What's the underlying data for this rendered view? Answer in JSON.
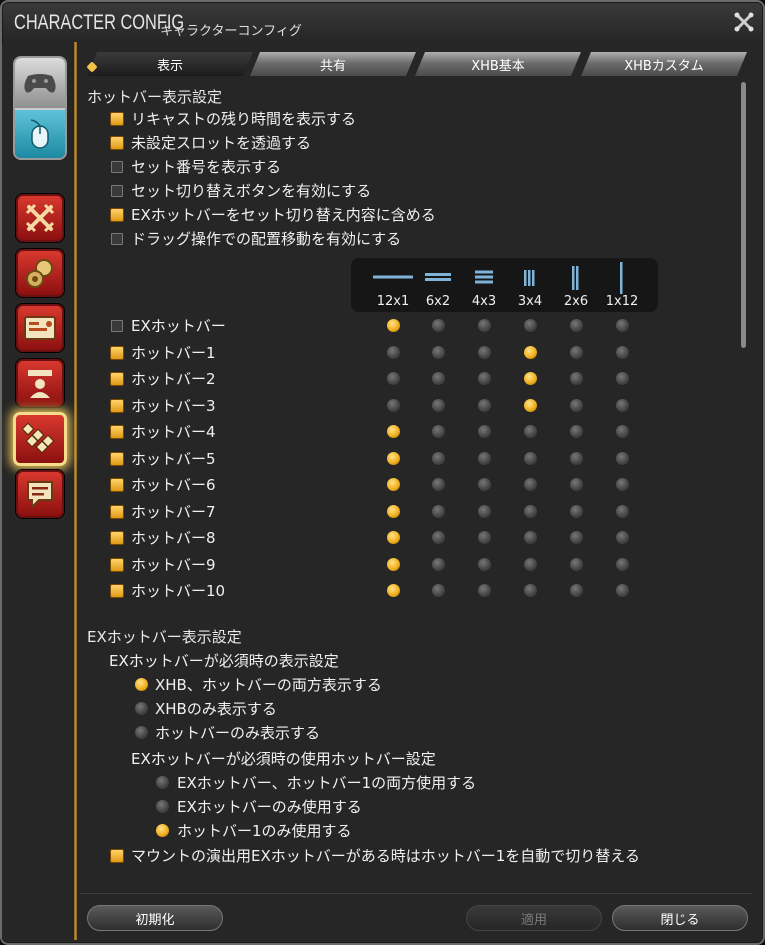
{
  "window": {
    "title_en": "CHARACTER CONFIG",
    "title_jp": "キャラクターコンフィグ"
  },
  "tabs": [
    {
      "label": "表示",
      "active": true
    },
    {
      "label": "共有",
      "active": false
    },
    {
      "label": "XHB基本",
      "active": false
    },
    {
      "label": "XHBカスタム",
      "active": false
    }
  ],
  "hotbar_display": {
    "heading": "ホットバー表示設定",
    "options": [
      {
        "label": "リキャストの残り時間を表示する",
        "checked": true
      },
      {
        "label": "未設定スロットを透過する",
        "checked": true
      },
      {
        "label": "セット番号を表示する",
        "checked": false
      },
      {
        "label": "セット切り替えボタンを有効にする",
        "checked": false
      },
      {
        "label": "EXホットバーをセット切り替え内容に含める",
        "checked": true
      },
      {
        "label": "ドラッグ操作での配置移動を有効にする",
        "checked": false
      }
    ]
  },
  "layouts": [
    "12x1",
    "6x2",
    "4x3",
    "3x4",
    "2x6",
    "1x12"
  ],
  "hotbar_rows": [
    {
      "label": "EXホットバー",
      "checked": false,
      "selected": 0
    },
    {
      "label": "ホットバー1",
      "checked": true,
      "selected": 3
    },
    {
      "label": "ホットバー2",
      "checked": true,
      "selected": 3
    },
    {
      "label": "ホットバー3",
      "checked": true,
      "selected": 3
    },
    {
      "label": "ホットバー4",
      "checked": true,
      "selected": 0
    },
    {
      "label": "ホットバー5",
      "checked": true,
      "selected": 0
    },
    {
      "label": "ホットバー6",
      "checked": true,
      "selected": 0
    },
    {
      "label": "ホットバー7",
      "checked": true,
      "selected": 0
    },
    {
      "label": "ホットバー8",
      "checked": true,
      "selected": 0
    },
    {
      "label": "ホットバー9",
      "checked": true,
      "selected": 0
    },
    {
      "label": "ホットバー10",
      "checked": true,
      "selected": 0
    }
  ],
  "ex_section": {
    "heading": "EXホットバー表示設定",
    "display_heading": "EXホットバーが必須時の表示設定",
    "display_options": [
      {
        "label": "XHB、ホットバーの両方表示する",
        "selected": true
      },
      {
        "label": "XHBのみ表示する",
        "selected": false
      },
      {
        "label": "ホットバーのみ表示する",
        "selected": false
      }
    ],
    "use_heading": "EXホットバーが必須時の使用ホットバー設定",
    "use_options": [
      {
        "label": "EXホットバー、ホットバー1の両方使用する",
        "selected": false
      },
      {
        "label": "EXホットバーのみ使用する",
        "selected": false
      },
      {
        "label": "ホットバー1のみ使用する",
        "selected": true
      }
    ],
    "mount_option": {
      "label": "マウントの演出用EXホットバーがある時はホットバー1を自動で切り替える",
      "checked": true
    }
  },
  "buttons": {
    "reset": "初期化",
    "apply": "適用",
    "close": "閉じる"
  },
  "colors": {
    "accent_gold": "#f0b020",
    "sidebar_red": "#c0241c",
    "divider_gold": "#c9962f"
  },
  "sidebar_icons": [
    "gamepad-icon",
    "mouse-icon",
    "crossed-swords-icon",
    "gear-bag-icon",
    "id-card-icon",
    "character-card-icon",
    "hotbar-icon",
    "chat-bubble-icon"
  ]
}
